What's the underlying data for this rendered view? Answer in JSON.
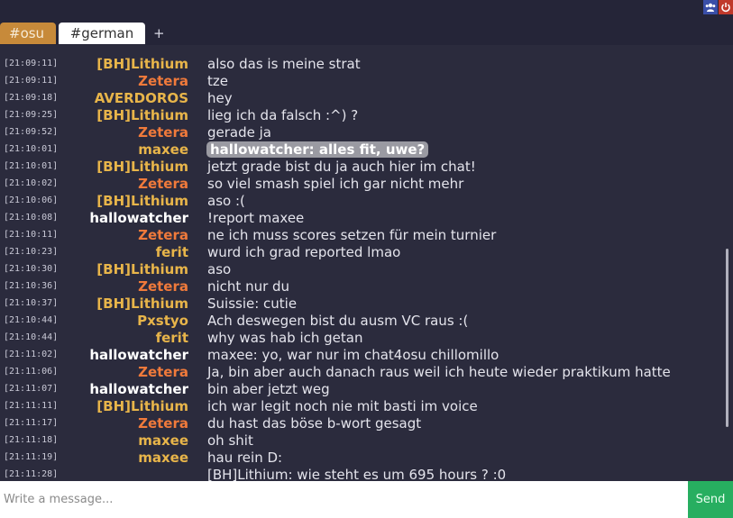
{
  "tabs": [
    {
      "label": "#osu"
    },
    {
      "label": "#german"
    }
  ],
  "add_tab_label": "+",
  "icons": {
    "users": "users-icon",
    "power": "power-icon"
  },
  "colors": {
    "nick_orange": "#f07a3b",
    "nick_yellow": "#e8b54a",
    "nick_white": "#ffffff",
    "send_green": "#27ae60"
  },
  "messages": [
    {
      "time": "[21:09:11]",
      "nick": "[BH]Lithium",
      "color": "#e8b54a",
      "text": "also das is meine strat"
    },
    {
      "time": "[21:09:11]",
      "nick": "Zetera",
      "color": "#f07a3b",
      "text": "tze"
    },
    {
      "time": "[21:09:18]",
      "nick": "AVERDOROS",
      "color": "#e8b54a",
      "text": "hey"
    },
    {
      "time": "[21:09:25]",
      "nick": "[BH]Lithium",
      "color": "#e8b54a",
      "text": "lieg ich da falsch :^) ?"
    },
    {
      "time": "[21:09:52]",
      "nick": "Zetera",
      "color": "#f07a3b",
      "text": "gerade ja"
    },
    {
      "time": "[21:10:01]",
      "nick": "maxee",
      "color": "#e8b54a",
      "text": "hallowatcher: alles fit, uwe?",
      "highlight": true
    },
    {
      "time": "[21:10:01]",
      "nick": "[BH]Lithium",
      "color": "#e8b54a",
      "text": "jetzt grade bist du ja auch hier im chat!"
    },
    {
      "time": "[21:10:02]",
      "nick": "Zetera",
      "color": "#f07a3b",
      "text": "so viel smash spiel ich gar nicht mehr"
    },
    {
      "time": "[21:10:06]",
      "nick": "[BH]Lithium",
      "color": "#e8b54a",
      "text": "aso :("
    },
    {
      "time": "[21:10:08]",
      "nick": "hallowatcher",
      "color": "#ffffff",
      "text": "!report maxee"
    },
    {
      "time": "[21:10:11]",
      "nick": "Zetera",
      "color": "#f07a3b",
      "text": "ne ich muss scores setzen für mein turnier"
    },
    {
      "time": "[21:10:23]",
      "nick": "ferit",
      "color": "#e8b54a",
      "text": "wurd ich grad reported lmao"
    },
    {
      "time": "[21:10:30]",
      "nick": "[BH]Lithium",
      "color": "#e8b54a",
      "text": "aso"
    },
    {
      "time": "[21:10:36]",
      "nick": "Zetera",
      "color": "#f07a3b",
      "text": "nicht nur du"
    },
    {
      "time": "[21:10:37]",
      "nick": "[BH]Lithium",
      "color": "#e8b54a",
      "text": "Suissie: cutie"
    },
    {
      "time": "[21:10:44]",
      "nick": "Pxstyo",
      "color": "#e8b54a",
      "text": "Ach deswegen bist du ausm VC raus :("
    },
    {
      "time": "[21:10:44]",
      "nick": "ferit",
      "color": "#e8b54a",
      "text": "why was hab ich getan"
    },
    {
      "time": "[21:11:02]",
      "nick": "hallowatcher",
      "color": "#ffffff",
      "text": "maxee: yo, war nur im chat4osu chillomillo"
    },
    {
      "time": "[21:11:06]",
      "nick": "Zetera",
      "color": "#f07a3b",
      "text": "Ja, bin aber auch danach raus weil ich heute wieder praktikum hatte"
    },
    {
      "time": "[21:11:07]",
      "nick": "hallowatcher",
      "color": "#ffffff",
      "text": "bin aber jetzt weg"
    },
    {
      "time": "[21:11:11]",
      "nick": "[BH]Lithium",
      "color": "#e8b54a",
      "text": "ich war legit noch nie mit basti im voice"
    },
    {
      "time": "[21:11:17]",
      "nick": "Zetera",
      "color": "#f07a3b",
      "text": "du hast das böse b-wort gesagt"
    },
    {
      "time": "[21:11:18]",
      "nick": "maxee",
      "color": "#e8b54a",
      "text": "oh shit"
    },
    {
      "time": "[21:11:19]",
      "nick": "maxee",
      "color": "#e8b54a",
      "text": "hau rein D:"
    },
    {
      "time": "[21:11:28]",
      "nick": "",
      "color": "#e8b54a",
      "text": "[BH]Lithium: wie steht es um 695 hours ? :0"
    }
  ],
  "composer": {
    "placeholder": "Write a message...",
    "send_label": "Send"
  }
}
